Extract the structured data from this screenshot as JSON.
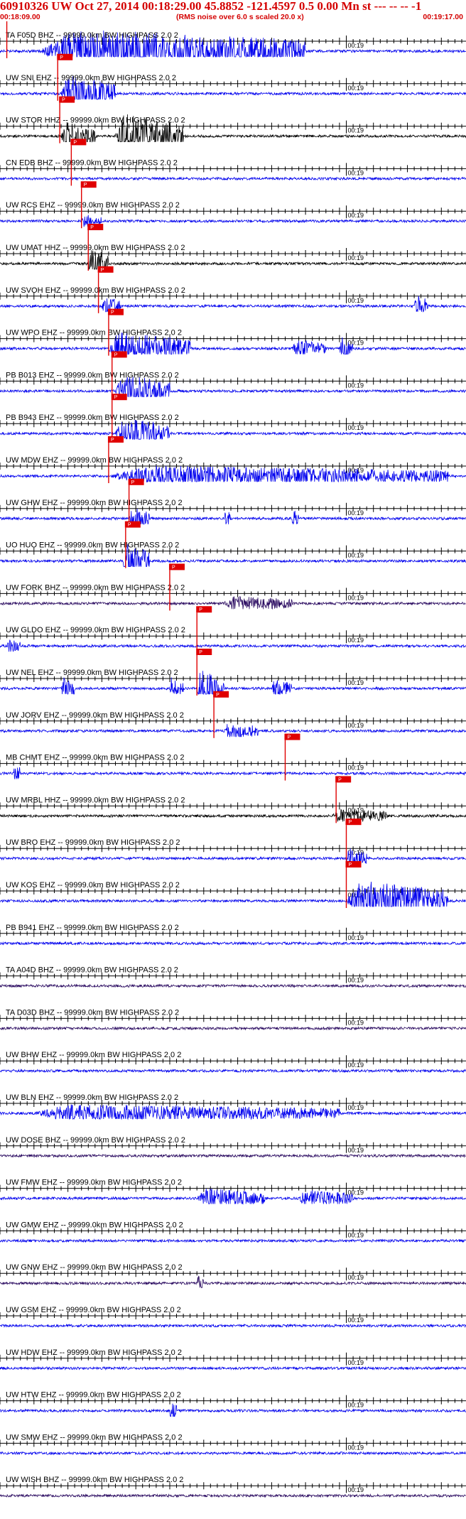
{
  "header": {
    "title": "60910326 UW Oct 27, 2014 00:18:29.00   45.8852 -121.4597  0.5 0.00 Mn st --- -- --   -1",
    "start_time": "00:18:09.00",
    "scale_note": "(RMS noise over 6.0 s scaled 20.0 x)",
    "end_time": "00:19:17.00",
    "minute_label": "00:19"
  },
  "colors": {
    "title": "#d40000",
    "trace_blue": "#0000ee",
    "trace_black": "#000000",
    "trace_purple": "#2a0a60",
    "pick": "#e00000",
    "axis": "#000000"
  },
  "chart_data": {
    "type": "line",
    "title": "60910326 UW Oct 27, 2014 00:18:29.00   45.8852 -121.4597  0.5 0.00 Mn st --- -- --   -1",
    "time_start": "00:18:09.00",
    "time_end": "00:19:17.00",
    "xlim_seconds": [
      0,
      68
    ],
    "minute_mark_seconds": 51,
    "pick_label": "P",
    "series": [
      {
        "name": "TA F05D BHZ -- 99999.0km BW  HIGHPASS  2.0  2",
        "color": "#0000ee",
        "pick_s": 1.0,
        "bursts": [
          {
            "t": 6,
            "dur": 39,
            "amp": 1.6
          }
        ]
      },
      {
        "name": "UW SNI EHZ -- 99999.0km BW  HIGHPASS  2.0  2",
        "color": "#0000ee",
        "pick_s": 8.5,
        "bursts": [
          {
            "t": 9,
            "dur": 8,
            "amp": 1.3
          }
        ]
      },
      {
        "name": "UW STOR HHZ -- 99999.0km BW  HIGHPASS  2.0  2",
        "color": "#000000",
        "pick_s": 8.8,
        "bursts": [
          {
            "t": 9,
            "dur": 5,
            "amp": 1.0
          },
          {
            "t": 17,
            "dur": 10,
            "amp": 1.6
          }
        ]
      },
      {
        "name": "CN EDB BHZ -- 99999.0km BW  HIGHPASS  2.0  2",
        "color": "#0000ee",
        "pick_s": 10.5,
        "bursts": []
      },
      {
        "name": "UW RCS EHZ -- 99999.0km BW  HIGHPASS  2.0  2",
        "color": "#0000ee",
        "pick_s": 12.0,
        "bursts": [
          {
            "t": 12,
            "dur": 3,
            "amp": 0.5
          }
        ]
      },
      {
        "name": "UW UMAT HHZ -- 99999.0km BW  HIGHPASS  2.0  2",
        "color": "#000000",
        "pick_s": 13.0,
        "bursts": [
          {
            "t": 13,
            "dur": 3,
            "amp": 1.1
          }
        ]
      },
      {
        "name": "UW SVOH EHZ -- 99999.0km BW  HIGHPASS  2.0  2",
        "color": "#0000ee",
        "pick_s": 14.5,
        "bursts": [
          {
            "t": 15,
            "dur": 3,
            "amp": 0.6
          },
          {
            "t": 61,
            "dur": 2,
            "amp": 0.8
          }
        ]
      },
      {
        "name": "UW WPO EHZ -- 99999.0km BW  HIGHPASS  2.0  2",
        "color": "#0000ee",
        "pick_s": 16.0,
        "bursts": [
          {
            "t": 16,
            "dur": 12,
            "amp": 1.2
          },
          {
            "t": 43,
            "dur": 5,
            "amp": 0.6
          },
          {
            "t": 50,
            "dur": 2,
            "amp": 0.8
          }
        ]
      },
      {
        "name": "PB B013 EHZ -- 99999.0km BW  HIGHPASS  2.0  2",
        "color": "#0000ee",
        "pick_s": 16.5,
        "bursts": [
          {
            "t": 17,
            "dur": 8,
            "amp": 1.2
          }
        ]
      },
      {
        "name": "PB B943 EHZ -- 99999.0km BW  HIGHPASS  2.0  2",
        "color": "#0000ee",
        "pick_s": 16.5,
        "bursts": [
          {
            "t": 17,
            "dur": 8,
            "amp": 1.2
          }
        ]
      },
      {
        "name": "UW MDW EHZ -- 99999.0km BW  HIGHPASS  2.0  2",
        "color": "#0000ee",
        "pick_s": 16.0,
        "bursts": [
          {
            "t": 16,
            "dur": 50,
            "amp": 0.7
          }
        ]
      },
      {
        "name": "UW GHW EHZ -- 99999.0km BW  HIGHPASS  2.0  2",
        "color": "#0000ee",
        "pick_s": 19.0,
        "bursts": [
          {
            "t": 19,
            "dur": 3,
            "amp": 0.8
          },
          {
            "t": 33,
            "dur": 1,
            "amp": 0.6
          },
          {
            "t": 43,
            "dur": 1,
            "amp": 0.6
          }
        ]
      },
      {
        "name": "UO HUO EHZ -- 99999.0km BW  HIGHPASS  2.0  2",
        "color": "#0000ee",
        "pick_s": 18.5,
        "bursts": [
          {
            "t": 18,
            "dur": 4,
            "amp": 1.3
          }
        ]
      },
      {
        "name": "UW FORK BHZ -- 99999.0km BW  HIGHPASS  2.0  2",
        "color": "#2a0a60",
        "pick_s": 25.0,
        "bursts": [
          {
            "t": 33,
            "dur": 10,
            "amp": 0.5
          }
        ]
      },
      {
        "name": "UW GLDO EHZ -- 99999.0km BW  HIGHPASS  2.0  2",
        "color": "#0000ee",
        "pick_s": 29.0,
        "bursts": [
          {
            "t": 1,
            "dur": 2,
            "amp": 0.5
          }
        ]
      },
      {
        "name": "UW NEL EHZ -- 99999.0km BW  HIGHPASS  2.0  2",
        "color": "#0000ee",
        "pick_s": 29.0,
        "bursts": [
          {
            "t": 9,
            "dur": 2,
            "amp": 0.8
          },
          {
            "t": 25,
            "dur": 2,
            "amp": 0.8
          },
          {
            "t": 29,
            "dur": 4,
            "amp": 1.5
          },
          {
            "t": 40,
            "dur": 3,
            "amp": 0.6
          }
        ]
      },
      {
        "name": "UW JORV EHZ -- 99999.0km BW  HIGHPASS  2.0  2",
        "color": "#0000ee",
        "pick_s": 31.5,
        "bursts": [
          {
            "t": 33,
            "dur": 5,
            "amp": 0.6
          }
        ]
      },
      {
        "name": "MB CHMT EHZ -- 99999.0km BW  HIGHPASS  2.0  2",
        "color": "#0000ee",
        "pick_s": 42.0,
        "bursts": [
          {
            "t": 2,
            "dur": 1,
            "amp": 0.7
          }
        ]
      },
      {
        "name": "UW MRBL HHZ -- 99999.0km BW  HIGHPASS  2.0  2",
        "color": "#000000",
        "pick_s": 49.5,
        "bursts": [
          {
            "t": 49,
            "dur": 8,
            "amp": 0.5
          }
        ]
      },
      {
        "name": "UW BRO EHZ -- 99999.0km BW  HIGHPASS  2.0  2",
        "color": "#0000ee",
        "pick_s": 51.0,
        "bursts": [
          {
            "t": 51,
            "dur": 3,
            "amp": 0.7
          }
        ]
      },
      {
        "name": "UW KOS EHZ -- 99999.0km BW  HIGHPASS  2.0  2",
        "color": "#0000ee",
        "pick_s": 51.0,
        "bursts": [
          {
            "t": 51,
            "dur": 15,
            "amp": 1.5
          }
        ]
      },
      {
        "name": "PB B941 EHZ -- 99999.0km BW  HIGHPASS  2.0  2",
        "color": "#0000ee",
        "pick_s": null,
        "bursts": []
      },
      {
        "name": "TA A04D BHZ -- 99999.0km BW  HIGHPASS  2.0  2",
        "color": "#2a0a60",
        "pick_s": null,
        "bursts": []
      },
      {
        "name": "TA D03D BHZ -- 99999.0km BW  HIGHPASS  2.0  2",
        "color": "#2a0a60",
        "pick_s": null,
        "bursts": []
      },
      {
        "name": "UW BHW EHZ -- 99999.0km BW  HIGHPASS  2.0  2",
        "color": "#0000ee",
        "pick_s": null,
        "bursts": []
      },
      {
        "name": "UW BLN EHZ -- 99999.0km BW  HIGHPASS  2.0  2",
        "color": "#0000ee",
        "pick_s": null,
        "bursts": [
          {
            "t": 5,
            "dur": 45,
            "amp": 0.6
          }
        ]
      },
      {
        "name": "UW DOSE BHZ -- 99999.0km BW  HIGHPASS  2.0  2",
        "color": "#2a0a60",
        "pick_s": null,
        "bursts": []
      },
      {
        "name": "UW FMW EHZ -- 99999.0km BW  HIGHPASS  2.0  2",
        "color": "#0000ee",
        "pick_s": null,
        "bursts": [
          {
            "t": 29,
            "dur": 10,
            "amp": 0.7
          },
          {
            "t": 44,
            "dur": 8,
            "amp": 0.6
          }
        ]
      },
      {
        "name": "UW GMW EHZ -- 99999.0km BW  HIGHPASS  2.0  2",
        "color": "#0000ee",
        "pick_s": null,
        "bursts": []
      },
      {
        "name": "UW GNW EHZ -- 99999.0km BW  HIGHPASS  2.0  2",
        "color": "#2a0a60",
        "pick_s": null,
        "bursts": [
          {
            "t": 29,
            "dur": 1,
            "amp": 0.5
          }
        ]
      },
      {
        "name": "UW GSM EHZ -- 99999.0km BW  HIGHPASS  2.0  2",
        "color": "#0000ee",
        "pick_s": null,
        "bursts": []
      },
      {
        "name": "UW HDW EHZ -- 99999.0km BW  HIGHPASS  2.0  2",
        "color": "#0000ee",
        "pick_s": null,
        "bursts": []
      },
      {
        "name": "UW HTW EHZ -- 99999.0km BW  HIGHPASS  2.0  2",
        "color": "#0000ee",
        "pick_s": null,
        "bursts": [
          {
            "t": 25,
            "dur": 1,
            "amp": 0.7
          }
        ]
      },
      {
        "name": "UW SMW EHZ -- 99999.0km BW  HIGHPASS  2.0  2",
        "color": "#0000ee",
        "pick_s": null,
        "bursts": []
      },
      {
        "name": "UW WISH BHZ -- 99999.0km BW  HIGHPASS  2.0  2",
        "color": "#2a0a60",
        "pick_s": null,
        "bursts": []
      }
    ]
  }
}
